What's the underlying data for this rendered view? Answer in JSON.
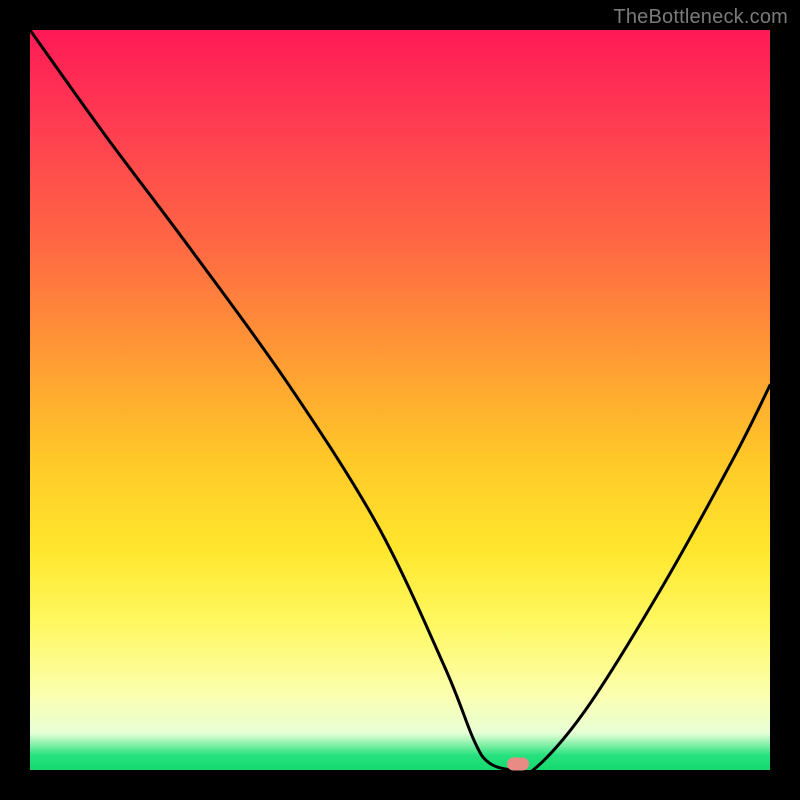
{
  "watermark": "TheBottleneck.com",
  "colors": {
    "frame": "#000000",
    "gradient_top": "#ff1a56",
    "gradient_bottom": "#14d96e",
    "curve": "#000000",
    "marker": "#e98b85"
  },
  "chart_data": {
    "type": "line",
    "title": "",
    "xlabel": "",
    "ylabel": "",
    "xlim": [
      0,
      100
    ],
    "ylim": [
      0,
      100
    ],
    "grid": false,
    "legend": false,
    "background": "rainbow-vertical-gradient",
    "series": [
      {
        "name": "bottleneck-curve",
        "x": [
          0,
          10,
          22,
          35,
          47,
          56,
          60,
          62,
          65,
          68,
          75,
          85,
          95,
          100
        ],
        "values": [
          100,
          86,
          70,
          52,
          33,
          14,
          4,
          1,
          0,
          0,
          8,
          24,
          42,
          52
        ]
      }
    ],
    "annotations": [
      {
        "name": "optimal-marker",
        "x": 66,
        "y": 0.8,
        "shape": "rounded-rect",
        "color": "#e98b85"
      }
    ]
  }
}
